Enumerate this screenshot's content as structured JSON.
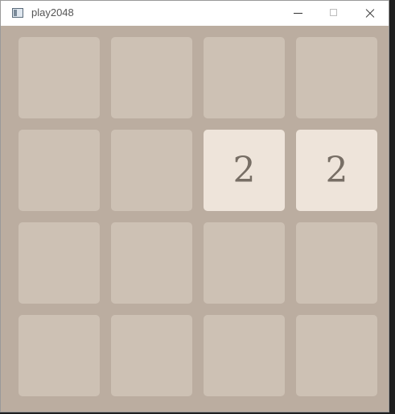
{
  "window": {
    "title": "play2048",
    "icon": "app-window-icon"
  },
  "board": {
    "size": 4,
    "cells": [
      [
        "",
        "",
        "",
        ""
      ],
      [
        "",
        "",
        "2",
        "2"
      ],
      [
        "",
        "",
        "",
        ""
      ],
      [
        "",
        "",
        "",
        ""
      ]
    ]
  },
  "colors": {
    "board_bg": "#bbada0",
    "empty_cell": "#cdc1b4",
    "tile_2": "#eee4da",
    "tile_text": "#776e65"
  }
}
